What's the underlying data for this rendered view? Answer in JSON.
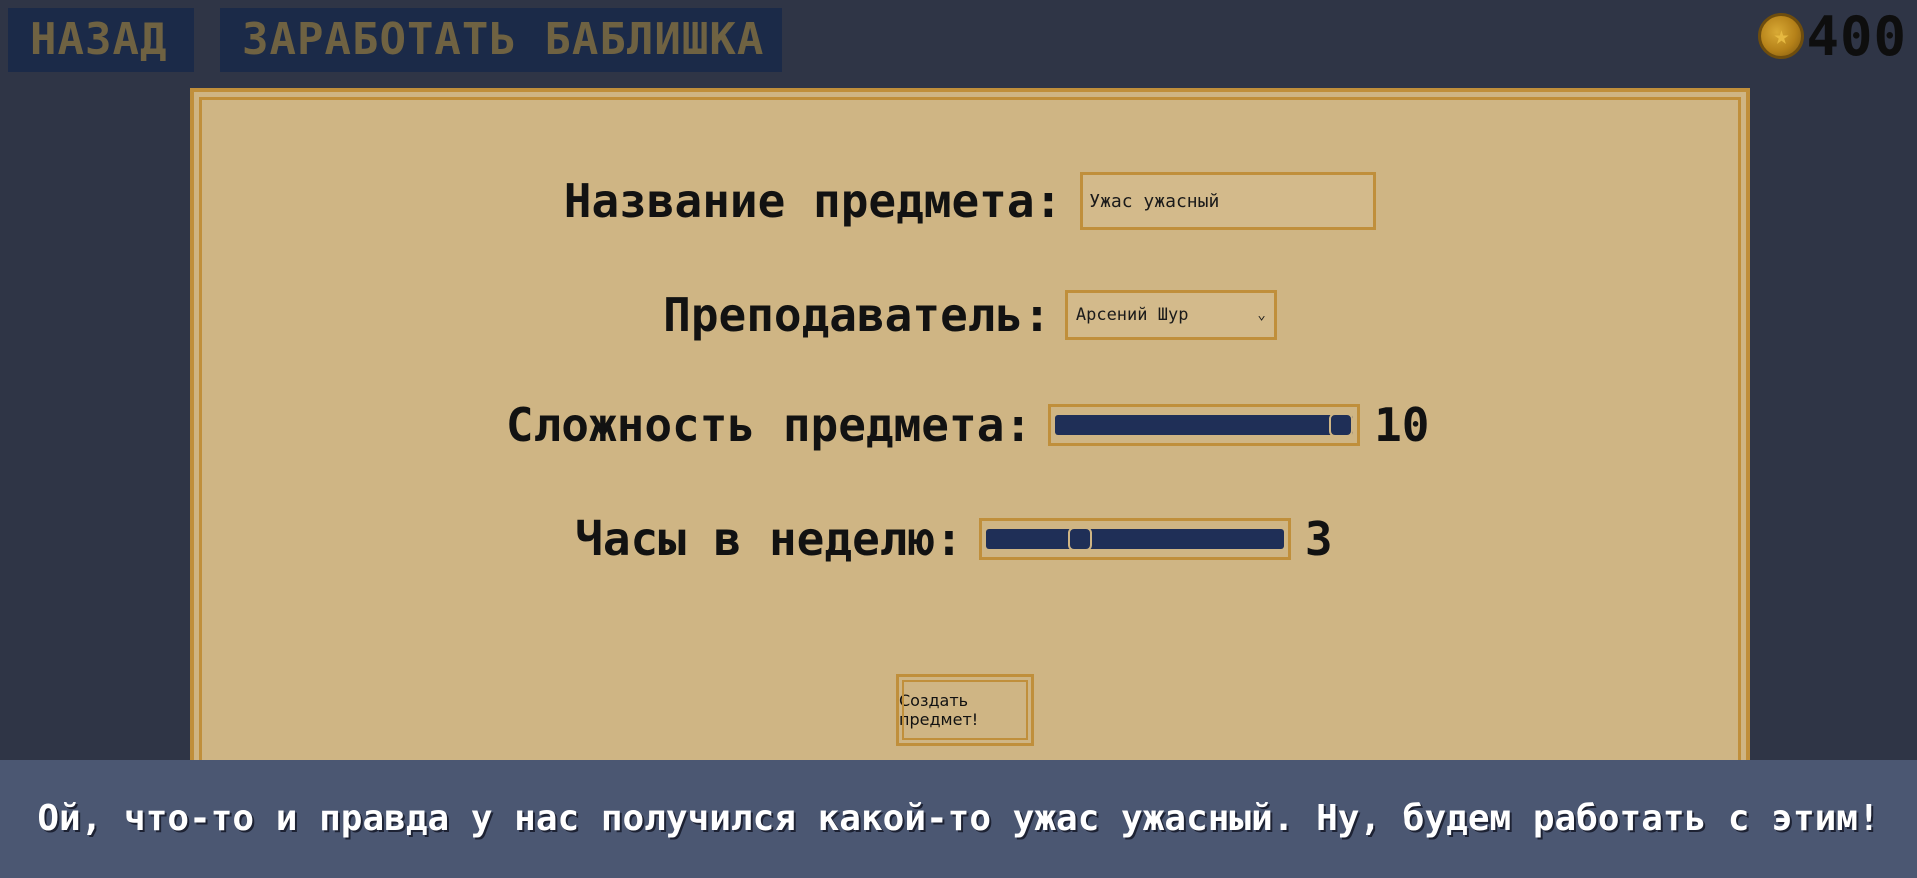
{
  "top_bar": {
    "back_label": "НАЗАД",
    "earn_label": "ЗАРАБОТАТЬ БАБЛИШКА",
    "coin_icon": "star-coin-icon",
    "coin_count": "400"
  },
  "form": {
    "item_name_label": "Название предмета:",
    "item_name_value": "Ужас ужасный",
    "teacher_label": "Преподаватель:",
    "teacher_selected": "Арсений Шур",
    "difficulty_label": "Сложность предмета:",
    "difficulty_value": "10",
    "difficulty_fraction": 1.0,
    "hours_label": "Часы в неделю:",
    "hours_value": "3",
    "hours_fraction": 0.3,
    "create_button_label": "Создать предмет!"
  },
  "dialog": {
    "text": "Ой, что-то и правда у нас получился какой-то ужас ужасный. Ну, будем работать с этим!"
  },
  "colors": {
    "background": "#2f3546",
    "panel": "#cfb584",
    "panel_border": "#c08f3b",
    "button_bg": "#1b2a48",
    "button_text": "#6f6242",
    "slider": "#1f2f57",
    "dialog_bg": "#4b5772"
  }
}
